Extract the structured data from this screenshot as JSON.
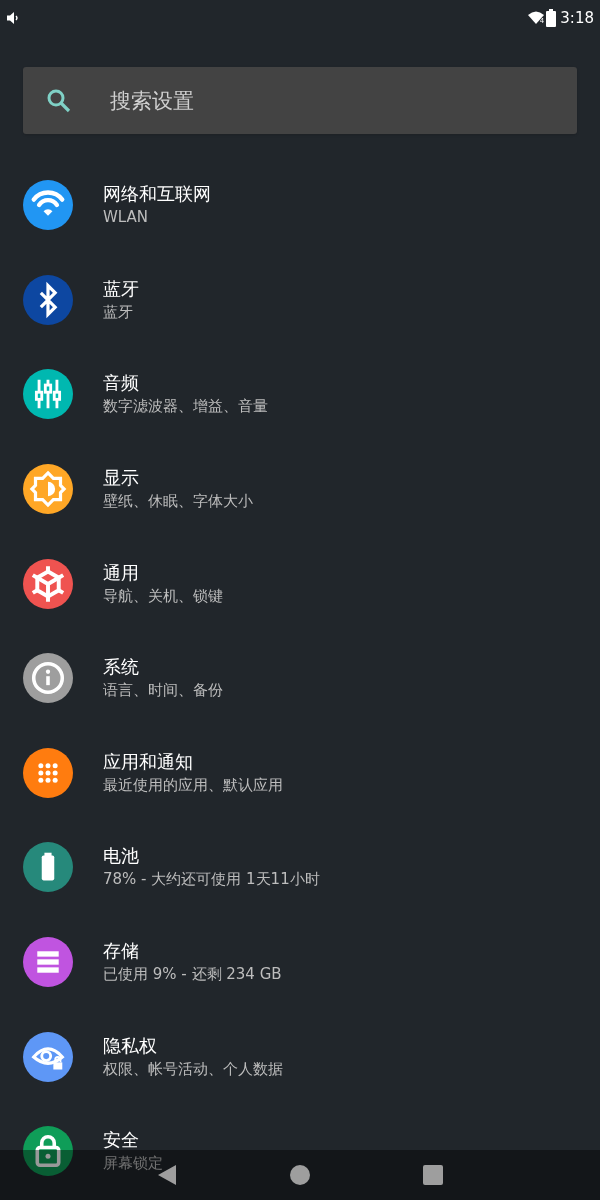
{
  "status_bar": {
    "time": "3:18",
    "signal_badge": "4"
  },
  "search": {
    "placeholder": "搜索设置"
  },
  "items": [
    {
      "title": "网络和互联网",
      "subtitle": "WLAN",
      "color": "#2196f3"
    },
    {
      "title": "蓝牙",
      "subtitle": "蓝牙",
      "color": "#0d47a1"
    },
    {
      "title": "音频",
      "subtitle": "数字滤波器、增益、音量",
      "color": "#00b8b0"
    },
    {
      "title": "显示",
      "subtitle": "壁纸、休眠、字体大小",
      "color": "#ffa726"
    },
    {
      "title": "通用",
      "subtitle": "导航、关机、锁键",
      "color": "#ef5350"
    },
    {
      "title": "系统",
      "subtitle": "语言、时间、备份",
      "color": "#9e9e9e"
    },
    {
      "title": "应用和通知",
      "subtitle": "最近使用的应用、默认应用",
      "color": "#ff7c0f"
    },
    {
      "title": "电池",
      "subtitle": "78% - 大约还可使用 1天11小时",
      "color": "#26897b"
    },
    {
      "title": "存储",
      "subtitle": "已使用 9% - 还剩 234 GB",
      "color": "#c054e0"
    },
    {
      "title": "隐私权",
      "subtitle": "权限、帐号活动、个人数据",
      "color": "#5e97f6"
    },
    {
      "title": "安全",
      "subtitle": "屏幕锁定",
      "color": "#0f9d58"
    }
  ]
}
